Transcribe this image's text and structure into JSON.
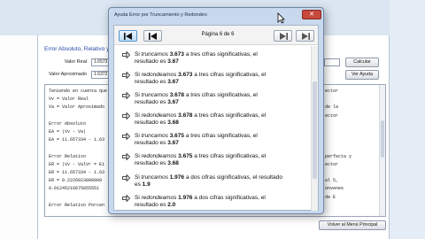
{
  "background": {
    "heading": "Error Absoluto, Relativo y P",
    "fields": [
      {
        "label": "Valor Real",
        "value": "1.6573"
      },
      {
        "label": "Valor Aproximado",
        "value": "1.6372"
      }
    ],
    "buttons": {
      "calc": "Calcular",
      "help": "Ver Ayuda",
      "back": "Volver al Menú Principal"
    },
    "text_lines": [
      "Teniendo en cuenta que",
      "Vv = Valor Real",
      "Va = Valor Aproximado",
      "",
      "Error Absoluto",
      "EA = |Vv - Va|",
      "EA = 11.657334 - 1.63",
      "",
      "Error Relativo",
      "ER = |Vv - ValVr = Ei",
      "ER = 11.657334 - 1.63",
      "ER = 0.2226023800000",
      "0.01245216675855551",
      "",
      "Error Relativo Porcen"
    ],
    "right_fragments": [
      "ector",
      "",
      "de la",
      "ector",
      "",
      "",
      "",
      "",
      "perfecta y",
      "ector",
      "",
      "al 5,",
      "onvenes",
      "de E"
    ]
  },
  "dialog": {
    "title": "Ayuda Error por Truncamiento y Redondeo",
    "close_label": "✕",
    "page_indicator": "Página 6 de 6",
    "items": [
      {
        "pre": "Si ",
        "verb": "truncamos",
        "num": "3.673",
        "mid": " a tres cifras significativas, el",
        "line2_pre": "resultado es ",
        "result": "3.67"
      },
      {
        "pre": "Si ",
        "verb": "redondeamos",
        "num": "3.673",
        "mid": " a tres cifras significativas, el",
        "line2_pre": "resultado es ",
        "result": "3.67"
      },
      {
        "pre": "Si ",
        "verb": "truncamos",
        "num": "3.678",
        "mid": " a tres cifras significativas, el",
        "line2_pre": "resultado es ",
        "result": "3.67"
      },
      {
        "pre": "Si ",
        "verb": "redondeamos",
        "num": "3.678",
        "mid": " a tres cifras significativas, el",
        "line2_pre": "resultado es ",
        "result": "3.68"
      },
      {
        "pre": "Si ",
        "verb": "truncamos",
        "num": "3.675",
        "mid": " a tres cifras significativas, el",
        "line2_pre": "resultado es ",
        "result": "3.67"
      },
      {
        "pre": "Si ",
        "verb": "redondeamos",
        "num": "3.675",
        "mid": " a tres cifras significativas, el",
        "line2_pre": "resultado es ",
        "result": "3.68"
      },
      {
        "pre": "Si ",
        "verb": "truncamos",
        "num": "1.976",
        "mid": " a dos cifras significativas, el resultado",
        "line2_pre": "es ",
        "result": "1.9"
      },
      {
        "pre": "Si ",
        "verb": "redondeamos",
        "num": "1.976",
        "mid": " a dos cifras significativas, el",
        "line2_pre": "resultado es ",
        "result": "2.0"
      }
    ]
  },
  "colors": {
    "accent": "#5a95c8",
    "dialog_frame": "#c8d9ee",
    "close": "#c74a3d",
    "heading": "#2a4aa8"
  }
}
